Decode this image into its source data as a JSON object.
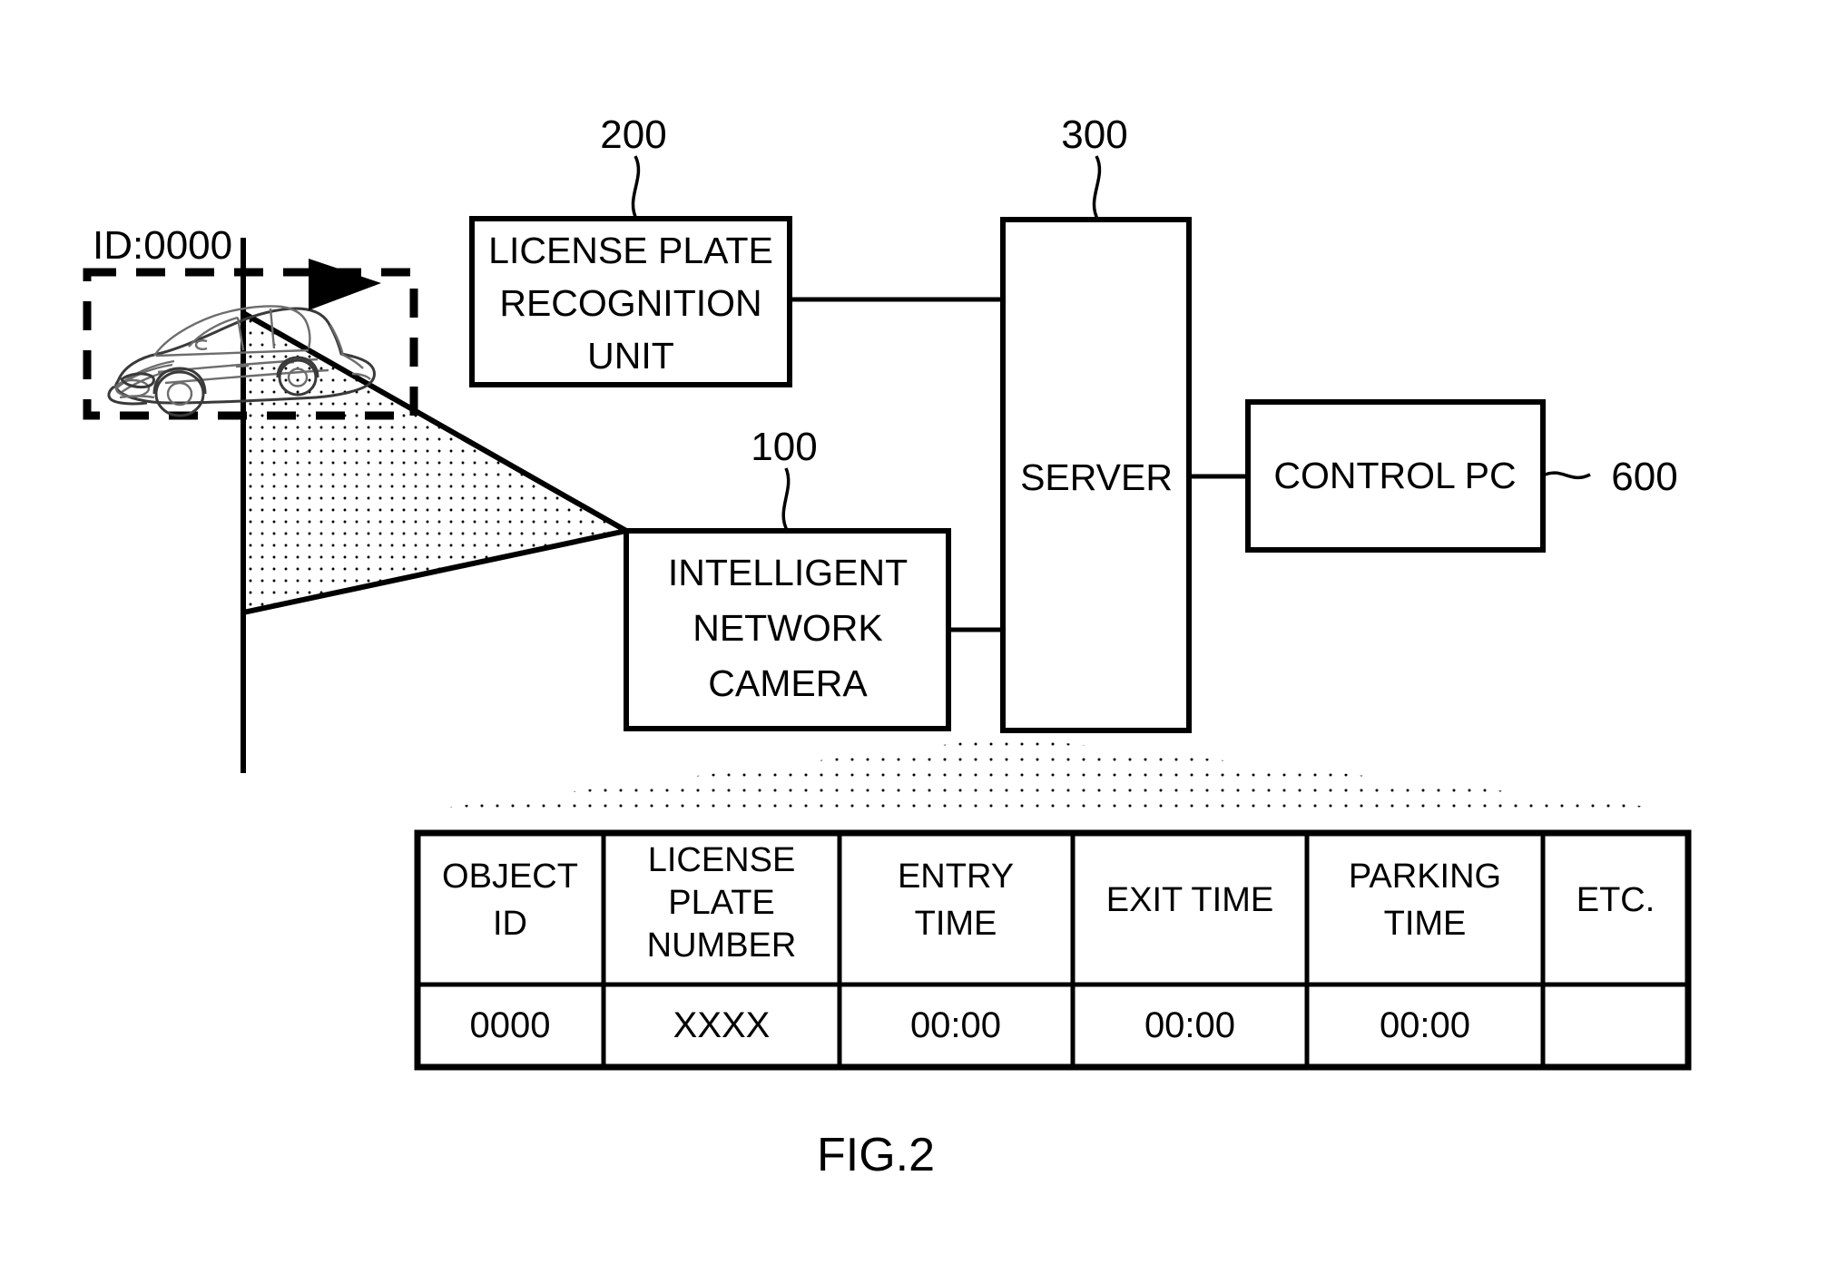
{
  "figure": {
    "caption": "FIG.2"
  },
  "vehicle": {
    "id_label": "ID:0000",
    "bounding_box_style": "dashed"
  },
  "blocks": [
    {
      "key": "license_plate_recognition_unit",
      "lines": [
        "LICENSE PLATE",
        "RECOGNITION",
        "UNIT"
      ],
      "ref": "200"
    },
    {
      "key": "intelligent_network_camera",
      "lines": [
        "INTELLIGENT",
        "NETWORK",
        "CAMERA"
      ],
      "ref": "100"
    },
    {
      "key": "server",
      "lines": [
        "SERVER"
      ],
      "ref": "300"
    },
    {
      "key": "control_pc",
      "lines": [
        "CONTROL PC"
      ],
      "ref": "600"
    }
  ],
  "refs": {
    "lpr_unit": "200",
    "camera": "100",
    "server": "300",
    "control_pc": "600"
  },
  "labels": {
    "lpr_line1": "LICENSE PLATE",
    "lpr_line2": "RECOGNITION",
    "lpr_line3": "UNIT",
    "cam_line1": "INTELLIGENT",
    "cam_line2": "NETWORK",
    "cam_line3": "CAMERA",
    "server": "SERVER",
    "control_pc": "CONTROL PC"
  },
  "table": {
    "headers": [
      {
        "lines": [
          "OBJECT",
          "ID"
        ]
      },
      {
        "lines": [
          "LICENSE",
          "PLATE",
          "NUMBER"
        ]
      },
      {
        "lines": [
          "ENTRY",
          "TIME"
        ]
      },
      {
        "lines": [
          "EXIT TIME"
        ]
      },
      {
        "lines": [
          "PARKING",
          "TIME"
        ]
      },
      {
        "lines": [
          "ETC."
        ]
      }
    ],
    "header_flat": {
      "object_id_1": "OBJECT",
      "object_id_2": "ID",
      "license_1": "LICENSE",
      "license_2": "PLATE",
      "license_3": "NUMBER",
      "entry_1": "ENTRY",
      "entry_2": "TIME",
      "exit_1": "EXIT TIME",
      "parking_1": "PARKING",
      "parking_2": "TIME",
      "etc_1": "ETC."
    },
    "rows": [
      {
        "object_id": "0000",
        "license_plate_number": "XXXX",
        "entry_time": "00:00",
        "exit_time": "00:00",
        "parking_time": "00:00",
        "etc": ""
      }
    ]
  },
  "colors": {
    "ink": "#000000",
    "paper": "#ffffff",
    "stipple": "#000000"
  }
}
